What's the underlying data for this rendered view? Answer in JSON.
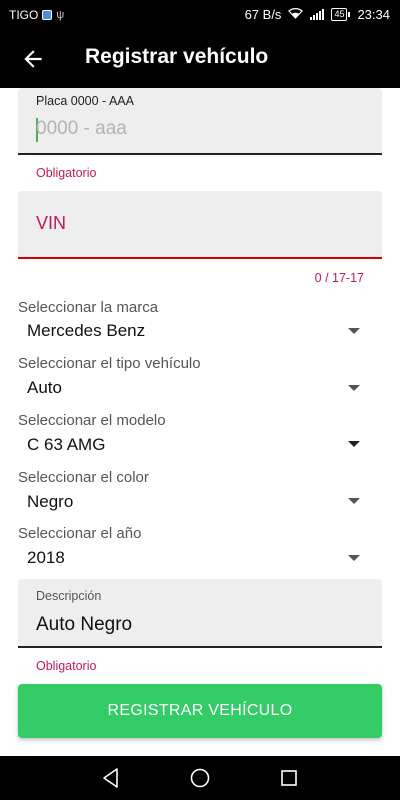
{
  "status_bar": {
    "carrier": "TIGO",
    "network_speed": "67 B/s",
    "battery": "45",
    "time": "23:34"
  },
  "app_bar": {
    "title": "Registrar vehículo",
    "back_icon": "arrow-back-icon"
  },
  "form": {
    "plate": {
      "label": "Placa 0000 - AAA",
      "placeholder": "0000 - aaa",
      "helper": "Obligatorio"
    },
    "vin": {
      "placeholder": "VIN",
      "counter": "0 / 17-17"
    },
    "dropdowns": [
      {
        "label": "Seleccionar la marca",
        "value": "Mercedes Benz"
      },
      {
        "label": "Seleccionar el tipo vehículo",
        "value": "Auto"
      },
      {
        "label": "Seleccionar el modelo",
        "value": "C 63 AMG"
      },
      {
        "label": "Seleccionar el color",
        "value": "Negro"
      },
      {
        "label": "Seleccionar el año",
        "value": "2018"
      }
    ],
    "description": {
      "label": "Descripción",
      "value": "Auto Negro",
      "helper": "Obligatorio"
    },
    "submit_label": "REGISTRAR VEHÍCULO"
  },
  "colors": {
    "accent_green": "#33cc66",
    "error_red": "#d50000",
    "helper_pink": "#c2185b"
  },
  "nav_bar": {
    "icons": [
      "nav-back-icon",
      "nav-home-icon",
      "nav-recents-icon"
    ]
  }
}
